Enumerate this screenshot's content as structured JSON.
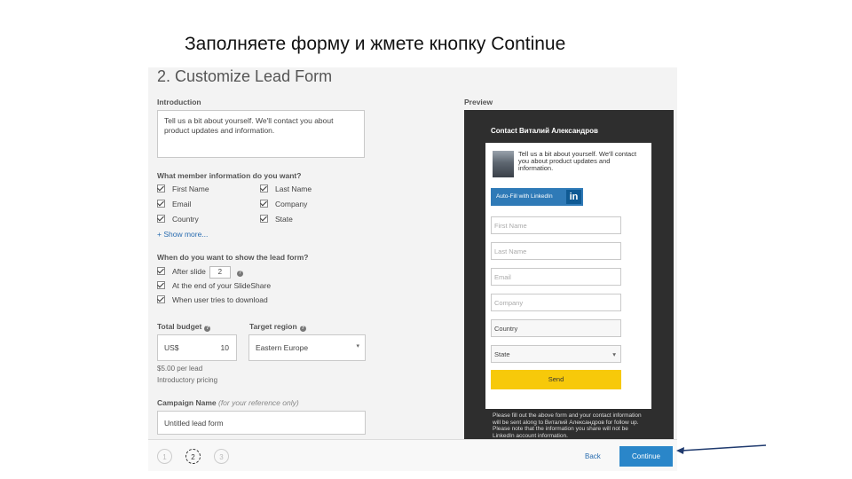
{
  "caption": "Заполняете форму и жмете кнопку Continue",
  "form": {
    "heading": "2. Customize Lead Form",
    "introduction_label": "Introduction",
    "introduction_text": "Tell us a bit about yourself. We'll contact you about product updates and information.",
    "member_info_label": "What member information do you want?",
    "checkboxes": [
      "First Name",
      "Last Name",
      "Email",
      "Company",
      "Country",
      "State"
    ],
    "show_more": "+ Show more...",
    "when_label": "When do you want to show the lead form?",
    "after_slide_label": "After slide",
    "after_slide_value": "2",
    "end_of_slideshare": "At the end of your SlideShare",
    "when_download": "When user tries to download",
    "total_budget_label": "Total budget",
    "target_region_label": "Target region",
    "budget_currency": "US$",
    "budget_value": "10",
    "region_value": "Eastern Europe",
    "per_lead": "$5.00 per lead",
    "intro_pricing": "Introductory pricing",
    "campaign_name_label": "Campaign Name",
    "campaign_name_hint": "(for your reference only)",
    "campaign_name_value": "Untitled lead form"
  },
  "preview": {
    "label": "Preview",
    "title": "Contact Виталий Александров",
    "card_text": "Tell us a bit about yourself. We'll contact you about product updates and information.",
    "autofill_label": "Auto-Fill with LinkedIn",
    "linkedin_mark": "in",
    "fields": [
      "First Name",
      "Last Name",
      "Email",
      "Company"
    ],
    "country": "Country",
    "state": "State",
    "send_label": "Send",
    "disclaimer": "Please fill out the above form and your contact information will be sent along to Виталий Александров for follow up. Please note that the information you share will not be LinkedIn account information."
  },
  "footer": {
    "steps": [
      "1",
      "2",
      "3"
    ],
    "current_step": "2",
    "back_label": "Back",
    "continue_label": "Continue"
  },
  "colors": {
    "continue_button": "#2a86c9",
    "send_button": "#f7c90a",
    "arrow": "#1f3a6e"
  }
}
